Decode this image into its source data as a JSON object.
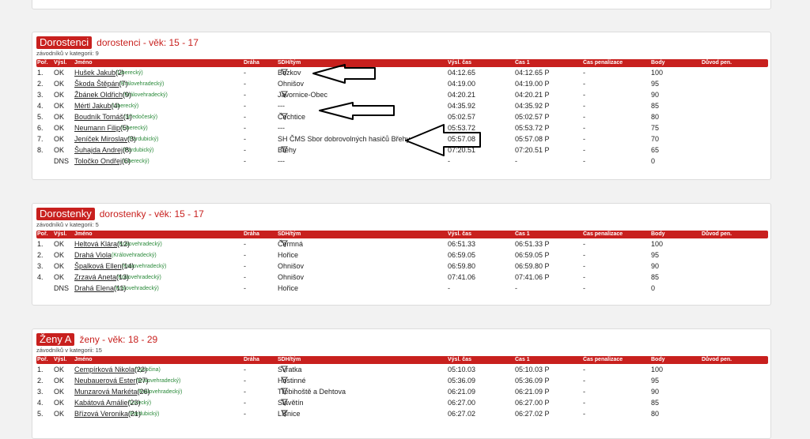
{
  "columns": {
    "por": "Poř.",
    "vysl": "Výsl.",
    "name": "Jméno",
    "draha": "Dráha",
    "sdh": "SDH/tým",
    "cas": "Výsl. čas",
    "cas1": "Čas 1",
    "pen": "Čas penalizace",
    "body": "Body",
    "duvod": "Důvod pen."
  },
  "categories": [
    {
      "badge": "Dorostenci",
      "title": "dorostenci - věk: 15 - 17",
      "count": "závodníků v kategorii: 9",
      "rows": [
        {
          "por": "1.",
          "vysl": "OK",
          "name": "Hušek Jakub",
          "club": "(Liberecký)",
          "num": "(2)",
          "draha": "-",
          "sdh": "Bozkov",
          "cas": "04:12.65",
          "cas1": "04:12.65 P",
          "pen": "-",
          "body": "100"
        },
        {
          "por": "2.",
          "vysl": "OK",
          "name": "Škoda Štěpán",
          "club": "(Královehradecký)",
          "num": "(7)",
          "draha": "-",
          "sdh": "Ohnišov",
          "cas": "04:19.00",
          "cas1": "04:19.00 P",
          "pen": "-",
          "body": "95"
        },
        {
          "por": "3.",
          "vysl": "OK",
          "name": "Žbánek Oldřich",
          "club": "(Královehradecký)",
          "num": "(9)",
          "draha": "-",
          "sdh": "Javornice-Obec",
          "cas": "04:20.21",
          "cas1": "04:20.21 P",
          "pen": "-",
          "body": "90"
        },
        {
          "por": "4.",
          "vysl": "OK",
          "name": "Mértl Jakub",
          "club": "(Liberecký)",
          "num": "(4)",
          "draha": "-",
          "sdh": "---",
          "cas": "04:35.92",
          "cas1": "04:35.92 P",
          "pen": "-",
          "body": "85"
        },
        {
          "por": "5.",
          "vysl": "OK",
          "name": "Boudník Tomáš",
          "club": "(Středočeský)",
          "num": "(1)",
          "draha": "-",
          "sdh": "Čechtice",
          "cas": "05:02.57",
          "cas1": "05:02.57 P",
          "pen": "-",
          "body": "80"
        },
        {
          "por": "6.",
          "vysl": "OK",
          "name": "Neumann Filip",
          "club": "(Liberecký)",
          "num": "(5)",
          "draha": "-",
          "sdh": "---",
          "cas": "05:53.72",
          "cas1": "05:53.72 P",
          "pen": "-",
          "body": "75"
        },
        {
          "por": "7.",
          "vysl": "OK",
          "name": "Jeníček Miroslav",
          "club": "(Pardubický)",
          "num": "(3)",
          "draha": "-",
          "sdh": "SH ČMS Sbor dobrovolných hasičů Břehy",
          "cas": "05:57.08",
          "cas1": "05:57.08 P",
          "pen": "-",
          "body": "70"
        },
        {
          "por": "8.",
          "vysl": "OK",
          "name": "Šuhajda Andrej",
          "club": "(Pardubický)",
          "num": "(8)",
          "draha": "-",
          "sdh": "Břehy",
          "cas": "07:20.51",
          "cas1": "07:20.51 P",
          "pen": "-",
          "body": "65"
        },
        {
          "por": "",
          "vysl": "DNS",
          "name": "Toločko Ondřej",
          "club": "(Liberecký)",
          "num": "(6)",
          "draha": "-",
          "sdh": "---",
          "cas": "-",
          "cas1": "-",
          "pen": "-",
          "body": "0"
        }
      ]
    },
    {
      "badge": "Dorostenky",
      "title": "dorostenky - věk: 15 - 17",
      "count": "závodníků v kategorii: 5",
      "rows": [
        {
          "por": "1.",
          "vysl": "OK",
          "name": "Heltová Klára",
          "club": "(Královehradecký)",
          "num": "(12)",
          "draha": "-",
          "sdh": "Čermná",
          "cas": "06:51.33",
          "cas1": "06:51.33 P",
          "pen": "-",
          "body": "100"
        },
        {
          "por": "2.",
          "vysl": "OK",
          "name": "Drahá Viola",
          "club": "(Královehradecký)",
          "num": "",
          "draha": "-",
          "sdh": "Hořice",
          "cas": "06:59.05",
          "cas1": "06:59.05 P",
          "pen": "-",
          "body": "95"
        },
        {
          "por": "3.",
          "vysl": "OK",
          "name": "Špalková Ellen",
          "club": "(Královehradecký)",
          "num": "(14)",
          "draha": "-",
          "sdh": "Ohnišov",
          "cas": "06:59.80",
          "cas1": "06:59.80 P",
          "pen": "-",
          "body": "90"
        },
        {
          "por": "4.",
          "vysl": "OK",
          "name": "Zrzavá Aneta",
          "club": "(Královehradecký)",
          "num": "(13)",
          "draha": "-",
          "sdh": "Ohnišov",
          "cas": "07:41.06",
          "cas1": "07:41.06 P",
          "pen": "-",
          "body": "85"
        },
        {
          "por": "",
          "vysl": "DNS",
          "name": "Drahá Elena",
          "club": "(Královehradecký)",
          "num": "(11)",
          "draha": "-",
          "sdh": "Hořice",
          "cas": "-",
          "cas1": "-",
          "pen": "-",
          "body": "0"
        }
      ]
    },
    {
      "badge": "Ženy A",
      "title": "ženy - věk: 18 - 29",
      "count": "závodníků v kategorii: 15",
      "rows": [
        {
          "por": "1.",
          "vysl": "OK",
          "name": "Cempírková Nikola",
          "club": "(Vysočina)",
          "num": "(22)",
          "draha": "-",
          "sdh": "Svratka",
          "cas": "05:10.03",
          "cas1": "05:10.03 P",
          "pen": "-",
          "body": "100"
        },
        {
          "por": "2.",
          "vysl": "OK",
          "name": "Neubauerová Ester",
          "club": "(Královehradecký)",
          "num": "(27)",
          "draha": "-",
          "sdh": "Hostinné",
          "cas": "05:36.09",
          "cas1": "05:36.09 P",
          "pen": "-",
          "body": "95"
        },
        {
          "por": "3.",
          "vysl": "OK",
          "name": "Munzarová Markéta",
          "club": "(Královehradecký)",
          "num": "(26)",
          "draha": "-",
          "sdh": "Třebihoště a Dehtova",
          "cas": "06:21.09",
          "cas1": "06:21.09 P",
          "pen": "-",
          "body": "90"
        },
        {
          "por": "4.",
          "vysl": "OK",
          "name": "Kabátová Amálie",
          "club": "(Ústecký)",
          "num": "(23)",
          "draha": "-",
          "sdh": "Slavětín",
          "cas": "06:27.00",
          "cas1": "06:27.00 P",
          "pen": "-",
          "body": "85"
        },
        {
          "por": "5.",
          "vysl": "OK",
          "name": "Břízová Veronika",
          "club": "(Pardubický)",
          "num": "(21)",
          "draha": "-",
          "sdh": "Líšnice",
          "cas": "06:27.02",
          "cas1": "06:27.02 P",
          "pen": "-",
          "body": "80"
        }
      ]
    }
  ],
  "filter_rows": {
    "0": [
      0,
      2,
      4,
      7
    ],
    "1": [
      0
    ],
    "2": [
      0,
      1,
      2,
      3,
      4
    ]
  },
  "colors": {
    "accent": "#c8201e",
    "club": "#2a8a3a"
  },
  "icons": {
    "filter": "filter-icon",
    "arrow": "annotation-arrow"
  }
}
